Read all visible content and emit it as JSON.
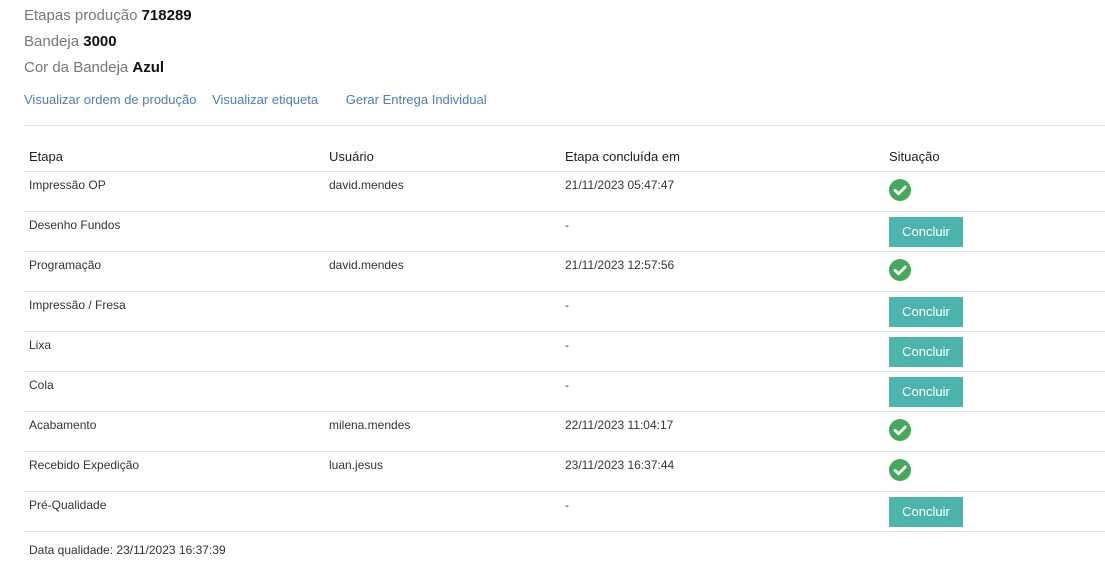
{
  "header": {
    "etapas_label": "Etapas produção",
    "etapas_value": "718289",
    "bandeja_label": "Bandeja",
    "bandeja_value": "3000",
    "cor_label": "Cor da Bandeja",
    "cor_value": "Azul"
  },
  "links": {
    "ordem": "Visualizar ordem de produção",
    "etiqueta": "Visualizar etiqueta",
    "entrega": "Gerar Entrega Individual"
  },
  "table": {
    "columns": [
      "Etapa",
      "Usuário",
      "Etapa concluída em",
      "Situação"
    ],
    "rows": [
      {
        "etapa": "Impressão OP",
        "usuario": "david.mendes",
        "concluida": "21/11/2023 05:47:47",
        "status": "done"
      },
      {
        "etapa": "Desenho Fundos",
        "usuario": "",
        "concluida": "-",
        "status": "pending"
      },
      {
        "etapa": "Programação",
        "usuario": "david.mendes",
        "concluida": "21/11/2023 12:57:56",
        "status": "done"
      },
      {
        "etapa": "Impressão / Fresa",
        "usuario": "",
        "concluida": "-",
        "status": "pending"
      },
      {
        "etapa": "Lixa",
        "usuario": "",
        "concluida": "-",
        "status": "pending"
      },
      {
        "etapa": "Cola",
        "usuario": "",
        "concluida": "-",
        "status": "pending"
      },
      {
        "etapa": "Acabamento",
        "usuario": "milena.mendes",
        "concluida": "22/11/2023 11:04:17",
        "status": "done"
      },
      {
        "etapa": "Recebido Expedição",
        "usuario": "luan.jesus",
        "concluida": "23/11/2023 16:37:44",
        "status": "done"
      },
      {
        "etapa": "Pré-Qualidade",
        "usuario": "",
        "concluida": "-",
        "status": "pending"
      }
    ],
    "concluir_label": "Concluir",
    "done_icon": "check-circle-icon",
    "done_color": "#45a85a",
    "button_color": "#4cb5ab"
  },
  "footer": {
    "data_qualidade": "Data qualidade: 23/11/2023 16:37:39"
  }
}
